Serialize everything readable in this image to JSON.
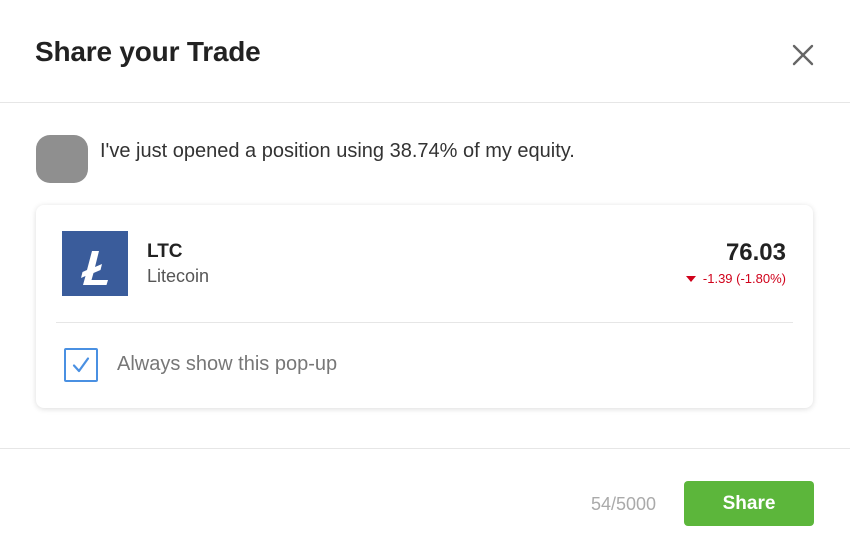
{
  "dialog": {
    "title": "Share your Trade"
  },
  "post": {
    "message": "I've just opened a position using 38.74% of my equity."
  },
  "instrument": {
    "ticker": "LTC",
    "name": "Litecoin",
    "price": "76.03",
    "change": "-1.39 (-1.80%)",
    "change_direction": "down",
    "logo_color": "#3a5c9b",
    "down_color": "#d0021b"
  },
  "options": {
    "always_show_label": "Always show this pop-up",
    "always_show_checked": true
  },
  "footer": {
    "char_counter": "54/5000",
    "share_label": "Share",
    "share_color": "#5cb63b"
  }
}
